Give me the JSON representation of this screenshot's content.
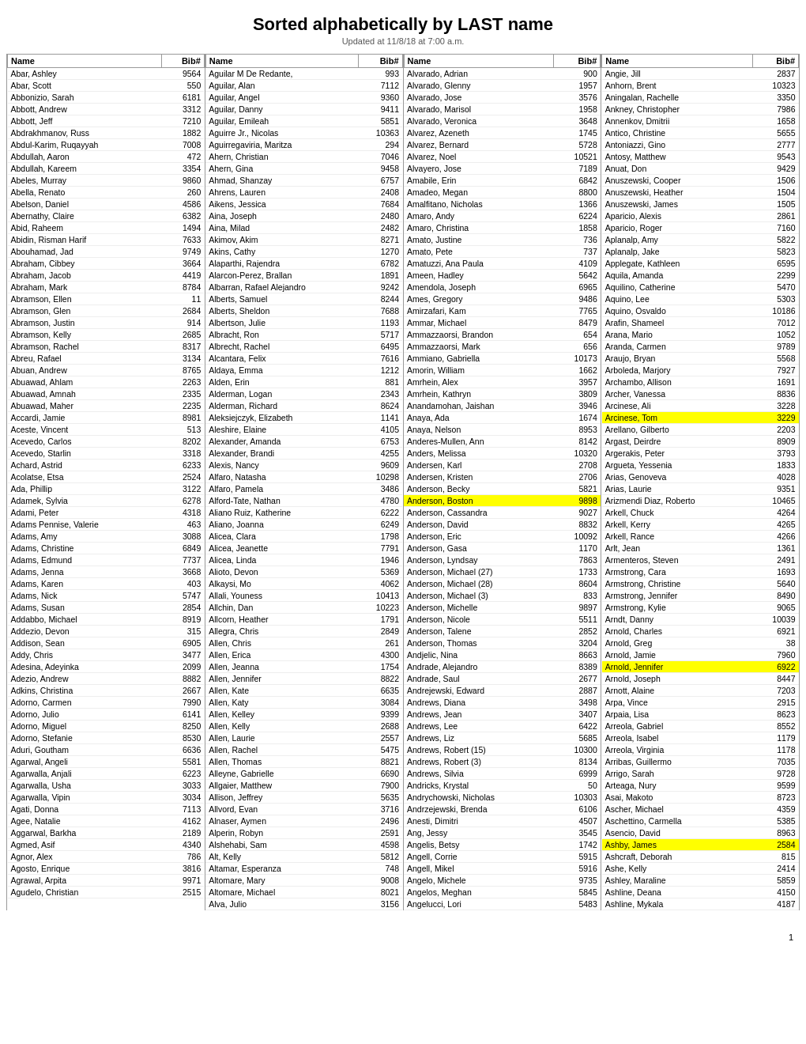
{
  "header": {
    "title": "Sorted alphabetically by LAST name",
    "subtitle": "Updated at 11/8/18 at 7:00 a.m.",
    "page_number": "1"
  },
  "columns": [
    {
      "id": "col1",
      "headers": [
        "Name",
        "Bib#"
      ],
      "rows": [
        [
          "Abar, Ashley",
          "9564"
        ],
        [
          "Abar, Scott",
          "550"
        ],
        [
          "Abbonizio, Sarah",
          "6181"
        ],
        [
          "Abbott, Andrew",
          "3312"
        ],
        [
          "Abbott, Jeff",
          "7210"
        ],
        [
          "Abdrakhmanov, Russ",
          "1882"
        ],
        [
          "Abdul-Karim, Ruqayyah",
          "7008"
        ],
        [
          "Abdullah, Aaron",
          "472"
        ],
        [
          "Abdullah, Kareem",
          "3354"
        ],
        [
          "Abeles, Murray",
          "9860"
        ],
        [
          "Abella, Renato",
          "260"
        ],
        [
          "Abelson, Daniel",
          "4586"
        ],
        [
          "Abernathy, Claire",
          "6382"
        ],
        [
          "Abid, Raheem",
          "1494"
        ],
        [
          "Abidin, Risman Harif",
          "7633"
        ],
        [
          "Abouhamad, Jad",
          "9749"
        ],
        [
          "Abraham, Cibbey",
          "3664"
        ],
        [
          "Abraham, Jacob",
          "4419"
        ],
        [
          "Abraham, Mark",
          "8784"
        ],
        [
          "Abramson, Ellen",
          "11"
        ],
        [
          "Abramson, Glen",
          "2684"
        ],
        [
          "Abramson, Justin",
          "914"
        ],
        [
          "Abramson, Kelly",
          "2685"
        ],
        [
          "Abramson, Rachel",
          "8317"
        ],
        [
          "Abreu, Rafael",
          "3134"
        ],
        [
          "Abuan, Andrew",
          "8765"
        ],
        [
          "Abuawad, Ahlam",
          "2263"
        ],
        [
          "Abuawad, Amnah",
          "2335"
        ],
        [
          "Abuawad, Maher",
          "2235"
        ],
        [
          "Accardi, Jamie",
          "8981"
        ],
        [
          "Aceste, Vincent",
          "513"
        ],
        [
          "Acevedo, Carlos",
          "8202"
        ],
        [
          "Acevedo, Starlin",
          "3318"
        ],
        [
          "Achard, Astrid",
          "6233"
        ],
        [
          "Acolatse, Etsa",
          "2524"
        ],
        [
          "Ada, Phillip",
          "3122"
        ],
        [
          "Adamek, Sylvia",
          "6278"
        ],
        [
          "Adami, Peter",
          "4318"
        ],
        [
          "Adams Pennise, Valerie",
          "463"
        ],
        [
          "Adams, Amy",
          "3088"
        ],
        [
          "Adams, Christine",
          "6849"
        ],
        [
          "Adams, Edmund",
          "7737"
        ],
        [
          "Adams, Jenna",
          "3668"
        ],
        [
          "Adams, Karen",
          "403"
        ],
        [
          "Adams, Nick",
          "5747"
        ],
        [
          "Adams, Susan",
          "2854"
        ],
        [
          "Addabbo, Michael",
          "8919"
        ],
        [
          "Addezio, Devon",
          "315"
        ],
        [
          "Addison, Sean",
          "6905"
        ],
        [
          "Addy, Chris",
          "3477"
        ],
        [
          "Adesina, Adeyinka",
          "2099"
        ],
        [
          "Adezio, Andrew",
          "8882"
        ],
        [
          "Adkins, Christina",
          "2667"
        ],
        [
          "Adorno, Carmen",
          "7990"
        ],
        [
          "Adorno, Julio",
          "6141"
        ],
        [
          "Adorno, Miguel",
          "8250"
        ],
        [
          "Adorno, Stefanie",
          "8530"
        ],
        [
          "Aduri, Goutham",
          "6636"
        ],
        [
          "Agarwal, Angeli",
          "5581"
        ],
        [
          "Agarwalla, Anjali",
          "6223"
        ],
        [
          "Agarwalla, Usha",
          "3033"
        ],
        [
          "Agarwalla, Vipin",
          "3034"
        ],
        [
          "Agati, Donna",
          "7113"
        ],
        [
          "Agee, Natalie",
          "4162"
        ],
        [
          "Aggarwal, Barkha",
          "2189"
        ],
        [
          "Agmed, Asif",
          "4340"
        ],
        [
          "Agnor, Alex",
          "786"
        ],
        [
          "Agosto, Enrique",
          "3816"
        ],
        [
          "Agrawal, Arpita",
          "9971"
        ],
        [
          "Agudelo, Christian",
          "2515"
        ]
      ]
    },
    {
      "id": "col2",
      "headers": [
        "Name",
        "Bib#"
      ],
      "rows": [
        [
          "Aguilar M De Redante,",
          "993"
        ],
        [
          "Aguilar, Alan",
          "7112"
        ],
        [
          "Aguilar, Angel",
          "9360"
        ],
        [
          "Aguilar, Danny",
          "9411"
        ],
        [
          "Aguilar, Emileah",
          "5851"
        ],
        [
          "Aguirre Jr., Nicolas",
          "10363"
        ],
        [
          "Aguirregaviria, Maritza",
          "294"
        ],
        [
          "Ahern, Christian",
          "7046"
        ],
        [
          "Ahern, Gina",
          "9458"
        ],
        [
          "Ahmad, Shanzay",
          "6757"
        ],
        [
          "Ahrens, Lauren",
          "2408"
        ],
        [
          "Aikens, Jessica",
          "7684"
        ],
        [
          "Aina, Joseph",
          "2480"
        ],
        [
          "Aina, Milad",
          "2482"
        ],
        [
          "Akimov, Akim",
          "8271"
        ],
        [
          "Akins, Cathy",
          "1270"
        ],
        [
          "Alaparthi, Rajendra",
          "6782"
        ],
        [
          "Alarcon-Perez, Brallan",
          "1891"
        ],
        [
          "Albarran, Rafael Alejandro",
          "9242"
        ],
        [
          "Alberts, Samuel",
          "8244"
        ],
        [
          "Alberts, Sheldon",
          "7688"
        ],
        [
          "Albertson, Julie",
          "1193"
        ],
        [
          "Albracht, Ron",
          "5717"
        ],
        [
          "Albrecht, Rachel",
          "6495"
        ],
        [
          "Alcantara, Felix",
          "7616"
        ],
        [
          "Aldaya, Emma",
          "1212"
        ],
        [
          "Alden, Erin",
          "881"
        ],
        [
          "Alderman, Logan",
          "2343"
        ],
        [
          "Alderman, Richard",
          "8624"
        ],
        [
          "Aleksiejczyk, Elizabeth",
          "1141"
        ],
        [
          "Aleshire, Elaine",
          "4105"
        ],
        [
          "Alexander, Amanda",
          "6753"
        ],
        [
          "Alexander, Brandi",
          "4255"
        ],
        [
          "Alexis, Nancy",
          "9609"
        ],
        [
          "Alfaro, Natasha",
          "10298"
        ],
        [
          "Alfaro, Pamela",
          "3486"
        ],
        [
          "Alford-Tate, Nathan",
          "4780"
        ],
        [
          "Aliano Ruiz, Katherine",
          "6222"
        ],
        [
          "Aliano, Joanna",
          "6249"
        ],
        [
          "Alicea, Clara",
          "1798"
        ],
        [
          "Alicea, Jeanette",
          "7791"
        ],
        [
          "Alicea, Linda",
          "1946"
        ],
        [
          "Alioto, Devon",
          "5369"
        ],
        [
          "Alkaysi, Mo",
          "4062"
        ],
        [
          "Allali, Youness",
          "10413"
        ],
        [
          "Allchin, Dan",
          "10223"
        ],
        [
          "Allcorn, Heather",
          "1791"
        ],
        [
          "Allegra, Chris",
          "2849"
        ],
        [
          "Allen, Chris",
          "261"
        ],
        [
          "Allen, Erica",
          "4300"
        ],
        [
          "Allen, Jeanna",
          "1754"
        ],
        [
          "Allen, Jennifer",
          "8822"
        ],
        [
          "Allen, Kate",
          "6635"
        ],
        [
          "Allen, Katy",
          "3084"
        ],
        [
          "Allen, Kelley",
          "9399"
        ],
        [
          "Allen, Kelly",
          "2688"
        ],
        [
          "Allen, Laurie",
          "2557"
        ],
        [
          "Allen, Rachel",
          "5475"
        ],
        [
          "Allen, Thomas",
          "8821"
        ],
        [
          "Alleyne, Gabrielle",
          "6690"
        ],
        [
          "Allgaier, Matthew",
          "7900"
        ],
        [
          "Allison, Jeffrey",
          "5635"
        ],
        [
          "Allvord, Evan",
          "3716"
        ],
        [
          "Alnaser, Aymen",
          "2496"
        ],
        [
          "Alperin, Robyn",
          "2591"
        ],
        [
          "Alshehabi, Sam",
          "4598"
        ],
        [
          "Alt, Kelly",
          "5812"
        ],
        [
          "Altamar, Esperanza",
          "748"
        ],
        [
          "Altomare, Mary",
          "9008"
        ],
        [
          "Altomare, Michael",
          "8021"
        ],
        [
          "Alva, Julio",
          "3156"
        ]
      ]
    },
    {
      "id": "col3",
      "headers": [
        "Name",
        "Bib#"
      ],
      "rows": [
        [
          "Alvarado, Adrian",
          "900"
        ],
        [
          "Alvarado, Glenny",
          "1957"
        ],
        [
          "Alvarado, Jose",
          "3576"
        ],
        [
          "Alvarado, Marisol",
          "1958"
        ],
        [
          "Alvarado, Veronica",
          "3648"
        ],
        [
          "Alvarez, Azeneth",
          "1745"
        ],
        [
          "Alvarez, Bernard",
          "5728"
        ],
        [
          "Alvarez, Noel",
          "10521"
        ],
        [
          "Alvayero, Jose",
          "7189"
        ],
        [
          "Amabile, Erin",
          "6842"
        ],
        [
          "Amadeo, Megan",
          "8800"
        ],
        [
          "Amalfitano, Nicholas",
          "1366"
        ],
        [
          "Amaro, Andy",
          "6224"
        ],
        [
          "Amaro, Christina",
          "1858"
        ],
        [
          "Amato, Justine",
          "736"
        ],
        [
          "Amato, Pete",
          "737"
        ],
        [
          "Amatuzzi, Ana Paula",
          "4109"
        ],
        [
          "Ameen, Hadley",
          "5642"
        ],
        [
          "Amendola, Joseph",
          "6965"
        ],
        [
          "Ames, Gregory",
          "9486"
        ],
        [
          "Amirzafari, Kam",
          "7765"
        ],
        [
          "Ammar, Michael",
          "8479"
        ],
        [
          "Ammazzaorsi, Brandon",
          "654"
        ],
        [
          "Ammazzaorsi, Mark",
          "656"
        ],
        [
          "Ammiano, Gabriella",
          "10173"
        ],
        [
          "Amorin, William",
          "1662"
        ],
        [
          "Amrhein, Alex",
          "3957"
        ],
        [
          "Amrhein, Kathryn",
          "3809"
        ],
        [
          "Anandamohan, Jaishan",
          "3946"
        ],
        [
          "Anaya, Ada",
          "1674"
        ],
        [
          "Anaya, Nelson",
          "8953"
        ],
        [
          "Anderes-Mullen, Ann",
          "8142"
        ],
        [
          "Anders, Melissa",
          "10320"
        ],
        [
          "Andersen, Karl",
          "2708"
        ],
        [
          "Andersen, Kristen",
          "2706"
        ],
        [
          "Anderson, Becky",
          "5821"
        ],
        [
          "Anderson, Boston",
          "9898",
          "highlight"
        ],
        [
          "Anderson, Cassandra",
          "9027"
        ],
        [
          "Anderson, David",
          "8832"
        ],
        [
          "Anderson, Eric",
          "10092"
        ],
        [
          "Anderson, Gasa",
          "1170"
        ],
        [
          "Anderson, Lyndsay",
          "7863"
        ],
        [
          "Anderson, Michael (27)",
          "1733"
        ],
        [
          "Anderson, Michael (28)",
          "8604"
        ],
        [
          "Anderson, Michael (3)",
          "833"
        ],
        [
          "Anderson, Michelle",
          "9897"
        ],
        [
          "Anderson, Nicole",
          "5511"
        ],
        [
          "Anderson, Talene",
          "2852"
        ],
        [
          "Anderson, Thomas",
          "3204"
        ],
        [
          "Andjelic, Nina",
          "8663"
        ],
        [
          "Andrade, Alejandro",
          "8389"
        ],
        [
          "Andrade, Saul",
          "2677"
        ],
        [
          "Andrejewski, Edward",
          "2887"
        ],
        [
          "Andrews, Diana",
          "3498"
        ],
        [
          "Andrews, Jean",
          "3407"
        ],
        [
          "Andrews, Lee",
          "6422"
        ],
        [
          "Andrews, Liz",
          "5685"
        ],
        [
          "Andrews, Robert (15)",
          "10300"
        ],
        [
          "Andrews, Robert (3)",
          "8134"
        ],
        [
          "Andrews, Silvia",
          "6999"
        ],
        [
          "Andricks, Krystal",
          "50"
        ],
        [
          "Andrychowski, Nicholas",
          "10303"
        ],
        [
          "Andrzejewski, Brenda",
          "6106"
        ],
        [
          "Anesti, Dimitri",
          "4507"
        ],
        [
          "Ang, Jessy",
          "3545"
        ],
        [
          "Angelis, Betsy",
          "1742"
        ],
        [
          "Angell, Corrie",
          "5915"
        ],
        [
          "Angell, Mikel",
          "5916"
        ],
        [
          "Angelo, Michele",
          "9735"
        ],
        [
          "Angelos, Meghan",
          "5845"
        ],
        [
          "Angelucci, Lori",
          "5483"
        ]
      ]
    },
    {
      "id": "col4",
      "headers": [
        "Name",
        "Bib#"
      ],
      "rows": [
        [
          "Angie, Jill",
          "2837"
        ],
        [
          "Anhorn, Brent",
          "10323"
        ],
        [
          "Aningalan, Rachelle",
          "3350"
        ],
        [
          "Ankney, Christopher",
          "7986"
        ],
        [
          "Annenkov, Dmitrii",
          "1658"
        ],
        [
          "Antico, Christine",
          "5655"
        ],
        [
          "Antoniazzi, Gino",
          "2777"
        ],
        [
          "Antosy, Matthew",
          "9543"
        ],
        [
          "Anuat, Don",
          "9429"
        ],
        [
          "Anuszewski, Cooper",
          "1506"
        ],
        [
          "Anuszewski, Heather",
          "1504"
        ],
        [
          "Anuszewski, James",
          "1505"
        ],
        [
          "Aparicio, Alexis",
          "2861"
        ],
        [
          "Aparicio, Roger",
          "7160"
        ],
        [
          "Aplanalp, Amy",
          "5822"
        ],
        [
          "Aplanalp, Jake",
          "5823"
        ],
        [
          "Applegate, Kathleen",
          "6595"
        ],
        [
          "Aquila, Amanda",
          "2299"
        ],
        [
          "Aquilino, Catherine",
          "5470"
        ],
        [
          "Aquino, Lee",
          "5303"
        ],
        [
          "Aquino, Osvaldo",
          "10186"
        ],
        [
          "Arafin, Shameel",
          "7012"
        ],
        [
          "Arana, Mario",
          "1052"
        ],
        [
          "Aranda, Carmen",
          "9789"
        ],
        [
          "Araujo, Bryan",
          "5568"
        ],
        [
          "Arboleda, Marjory",
          "7927"
        ],
        [
          "Archambo, Allison",
          "1691"
        ],
        [
          "Archer, Vanessa",
          "8836"
        ],
        [
          "Arcinese, Ali",
          "3228"
        ],
        [
          "Arcinese, Tom",
          "3229",
          "highlight"
        ],
        [
          "Arellano, Gilberto",
          "2203"
        ],
        [
          "Argast, Deirdre",
          "8909"
        ],
        [
          "Argerakis, Peter",
          "3793"
        ],
        [
          "Argueta, Yessenia",
          "1833"
        ],
        [
          "Arias, Genoveva",
          "4028"
        ],
        [
          "Arias, Laurie",
          "9351"
        ],
        [
          "Arizmendi Diaz, Roberto",
          "10465"
        ],
        [
          "Arkell, Chuck",
          "4264"
        ],
        [
          "Arkell, Kerry",
          "4265"
        ],
        [
          "Arkell, Rance",
          "4266"
        ],
        [
          "Arlt, Jean",
          "1361"
        ],
        [
          "Armenteros, Steven",
          "2491"
        ],
        [
          "Armstrong, Cara",
          "1693"
        ],
        [
          "Armstrong, Christine",
          "5640"
        ],
        [
          "Armstrong, Jennifer",
          "8490"
        ],
        [
          "Armstrong, Kylie",
          "9065"
        ],
        [
          "Arndt, Danny",
          "10039"
        ],
        [
          "Arnold, Charles",
          "6921"
        ],
        [
          "Arnold, Greg",
          "38"
        ],
        [
          "Arnold, Jamie",
          "7960"
        ],
        [
          "Arnold, Jennifer",
          "6922",
          "highlight"
        ],
        [
          "Arnold, Joseph",
          "8447"
        ],
        [
          "Arnott, Alaine",
          "7203"
        ],
        [
          "Arpa, Vince",
          "2915"
        ],
        [
          "Arpaia, Lisa",
          "8623"
        ],
        [
          "Arreola, Gabriel",
          "8552"
        ],
        [
          "Arreola, Isabel",
          "1179"
        ],
        [
          "Arreola, Virginia",
          "1178"
        ],
        [
          "Arribas, Guillermo",
          "7035"
        ],
        [
          "Arrigo, Sarah",
          "9728"
        ],
        [
          "Arteaga, Nury",
          "9599"
        ],
        [
          "Asai, Makoto",
          "8723"
        ],
        [
          "Ascher, Michael",
          "4359"
        ],
        [
          "Aschettino, Carmella",
          "5385"
        ],
        [
          "Asencio, David",
          "8963"
        ],
        [
          "Ashby, James",
          "2584",
          "highlight"
        ],
        [
          "Ashcraft, Deborah",
          "815"
        ],
        [
          "Ashe, Kelly",
          "2414"
        ],
        [
          "Ashley, Maraline",
          "5859"
        ],
        [
          "Ashline, Deana",
          "4150"
        ],
        [
          "Ashline, Mykala",
          "4187"
        ]
      ]
    }
  ]
}
